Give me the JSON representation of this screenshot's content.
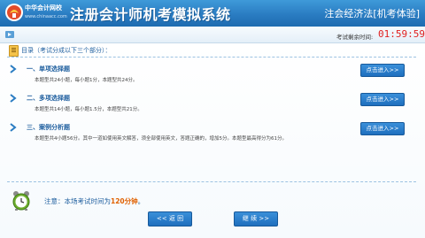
{
  "header": {
    "logo_name": "中华会计网校",
    "logo_url": "www.chinaacc.com",
    "app_title": "注册会计师机考模拟系统",
    "subject": "注会经济法[机考体验]"
  },
  "timer": {
    "label": "考试剩余时间:",
    "value": "01:59:59"
  },
  "toc": {
    "title": "目录（考试分成以下三个部分）："
  },
  "sections": [
    {
      "title": "一、单项选择题",
      "desc": "本题型共24小题，每小题1分，本题型共24分。",
      "button": "点击进入>>"
    },
    {
      "title": "二、多项选择题",
      "desc": "本题型共14小题，每小题1.5分，本题型共21分。",
      "button": "点击进入>>"
    },
    {
      "title": "三、案例分析题",
      "desc": "本题型共4小题56分。其中一道如使用英文解答，须全部使用英文，答题正确的，增加5分。本题型最高得分为61分。",
      "button": "点击进入>>"
    }
  ],
  "notice": {
    "prefix": "注意：本场考试时间为",
    "highlight": "120分钟",
    "suffix": "。"
  },
  "nav": {
    "back": "<< 返  回",
    "next": "继  续 >>"
  },
  "colors": {
    "header_blue": "#2a7cc2",
    "timer_red": "#e02020",
    "button_blue": "#1f6fbe",
    "highlight_orange": "#e06000"
  }
}
